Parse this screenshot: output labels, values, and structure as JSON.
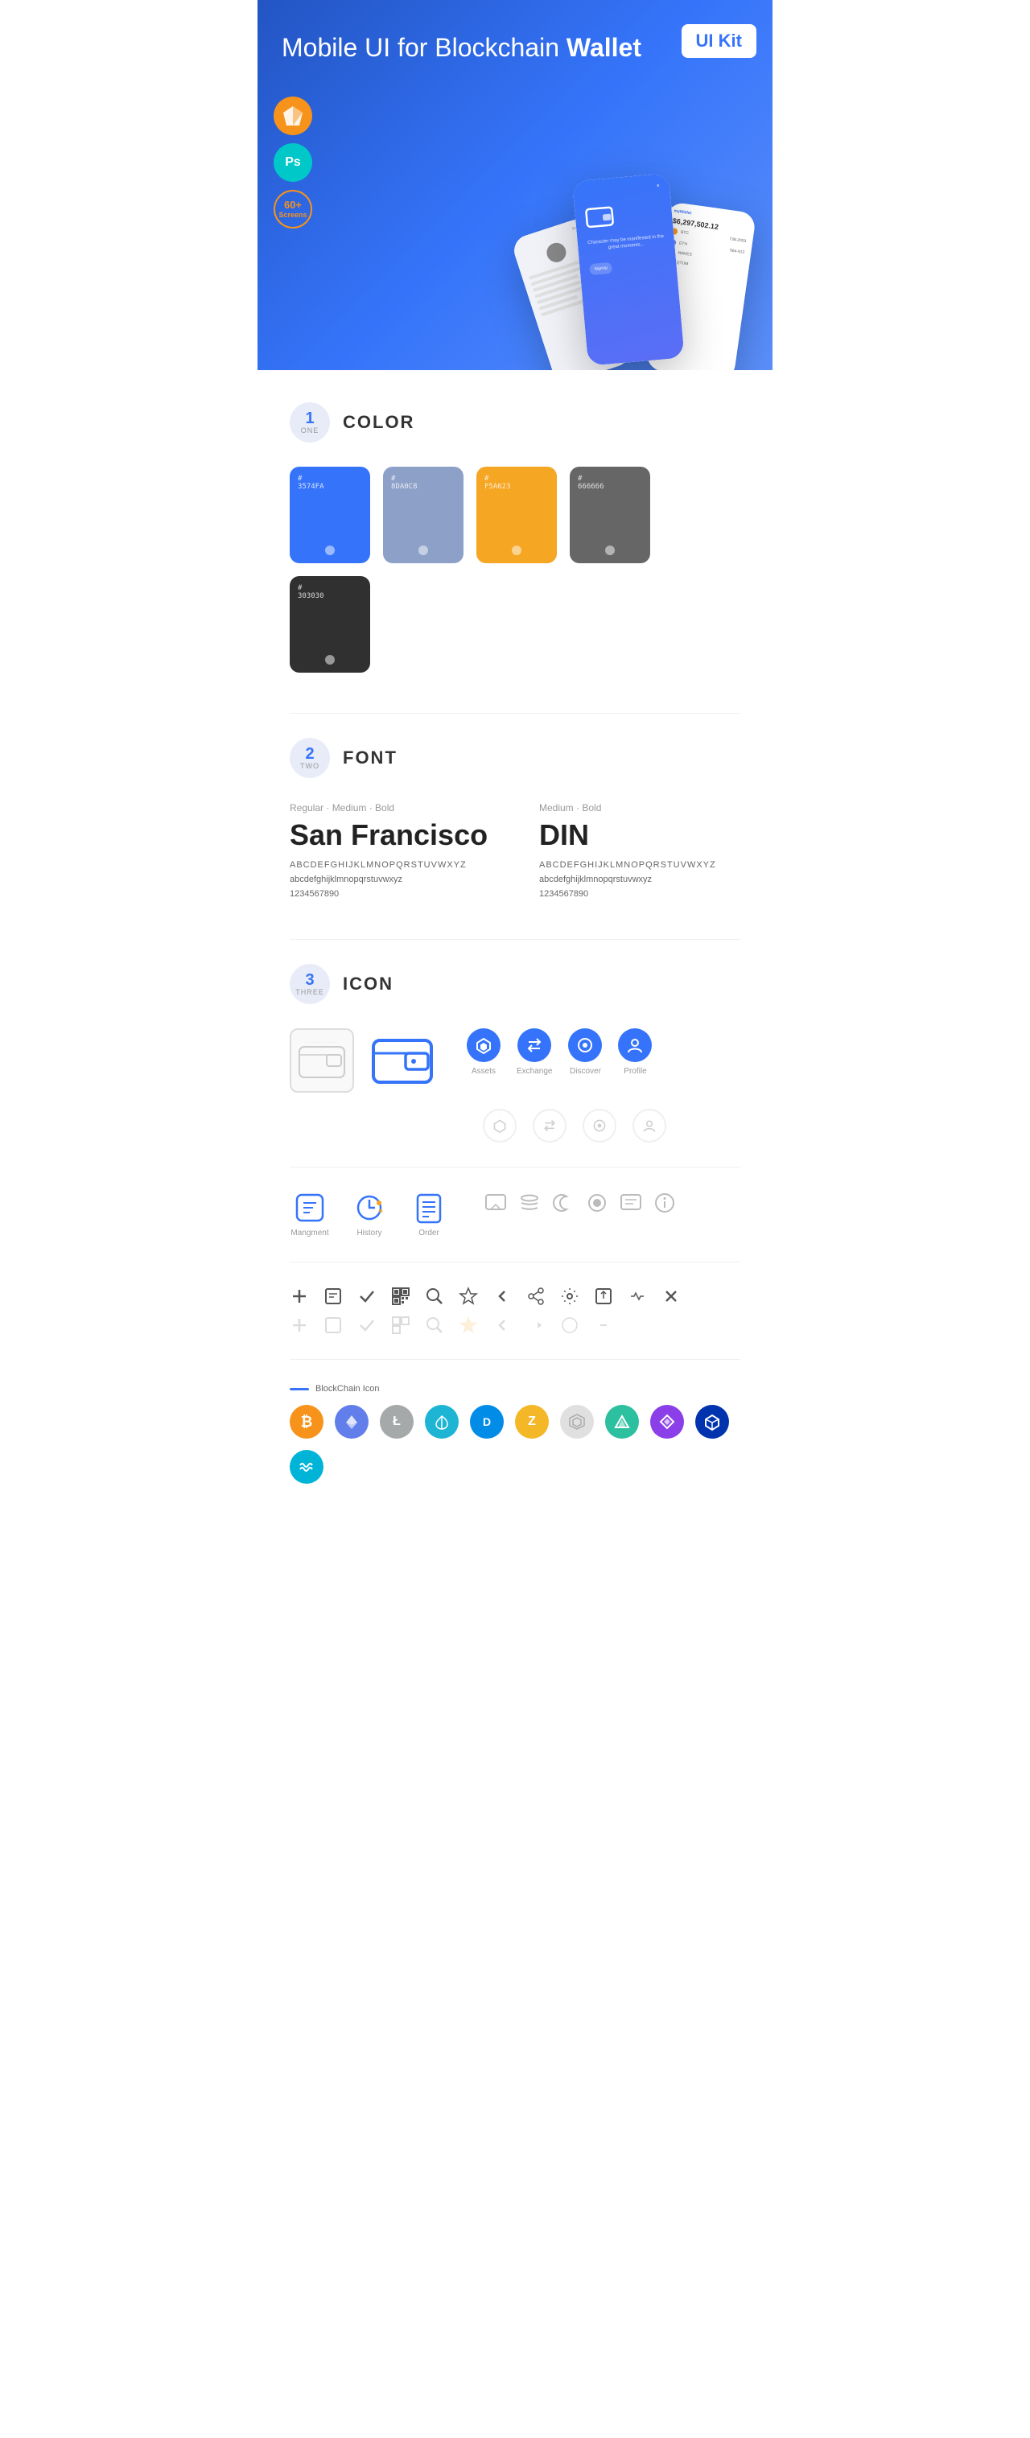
{
  "hero": {
    "title_normal": "Mobile UI for Blockchain ",
    "title_bold": "Wallet",
    "ui_kit_label": "UI Kit",
    "sketch_label": "Sketch",
    "ps_label": "Ps",
    "screens_label": "60+\nScreens"
  },
  "sections": {
    "color": {
      "number": "1",
      "word": "ONE",
      "title": "COLOR",
      "swatches": [
        {
          "hex": "#3574FA",
          "code": "#\n3574FA"
        },
        {
          "hex": "#8DA0C8",
          "code": "#\n8DA0C8"
        },
        {
          "hex": "#F5A623",
          "code": "#\nF5A623"
        },
        {
          "hex": "#666666",
          "code": "#\n666666"
        },
        {
          "hex": "#303030",
          "code": "#\n303030"
        }
      ]
    },
    "font": {
      "number": "2",
      "word": "TWO",
      "title": "FONT",
      "fonts": [
        {
          "styles": "Regular · Medium · Bold",
          "name": "San Francisco",
          "uppercase": "ABCDEFGHIJKLMNOPQRSTUVWXYZ",
          "lowercase": "abcdefghijklmnopqrstuvwxyz",
          "numbers": "1234567890"
        },
        {
          "styles": "Medium · Bold",
          "name": "DIN",
          "uppercase": "ABCDEFGHIJKLMNOPQRSTUVWXYZ",
          "lowercase": "abcdefghijklmnopqrstuvwxyz",
          "numbers": "1234567890"
        }
      ]
    },
    "icon": {
      "number": "3",
      "word": "THREE",
      "title": "ICON",
      "nav_icons": [
        {
          "label": "Assets",
          "color": "#3574FA"
        },
        {
          "label": "Exchange",
          "color": "#3574FA"
        },
        {
          "label": "Discover",
          "color": "#3574FA"
        },
        {
          "label": "Profile",
          "color": "#3574FA"
        }
      ],
      "bottom_nav": [
        {
          "label": "Mangment"
        },
        {
          "label": "History"
        },
        {
          "label": "Order"
        }
      ],
      "blockchain_label": "BlockChain Icon",
      "crypto_coins": [
        {
          "symbol": "₿",
          "color": "#f7931a",
          "name": "Bitcoin"
        },
        {
          "symbol": "Ξ",
          "color": "#627eea",
          "name": "Ethereum"
        },
        {
          "symbol": "Ł",
          "color": "#a6a9aa",
          "name": "Litecoin"
        },
        {
          "symbol": "◆",
          "color": "#1eb4d4",
          "name": "Nem"
        },
        {
          "symbol": "D",
          "color": "#008ce7",
          "name": "Dash"
        },
        {
          "symbol": "Z",
          "color": "#f4b728",
          "name": "Zcash"
        },
        {
          "symbol": "✦",
          "color": "#aaa",
          "name": "Grid"
        },
        {
          "symbol": "▲",
          "color": "#2cc0a0",
          "name": "Augur"
        },
        {
          "symbol": "◇",
          "color": "#8b3fe8",
          "name": "Dfinity"
        },
        {
          "symbol": "◈",
          "color": "#0033ad",
          "name": "Matic"
        },
        {
          "symbol": "~",
          "color": "#00b4d8",
          "name": "Waves"
        }
      ]
    }
  }
}
